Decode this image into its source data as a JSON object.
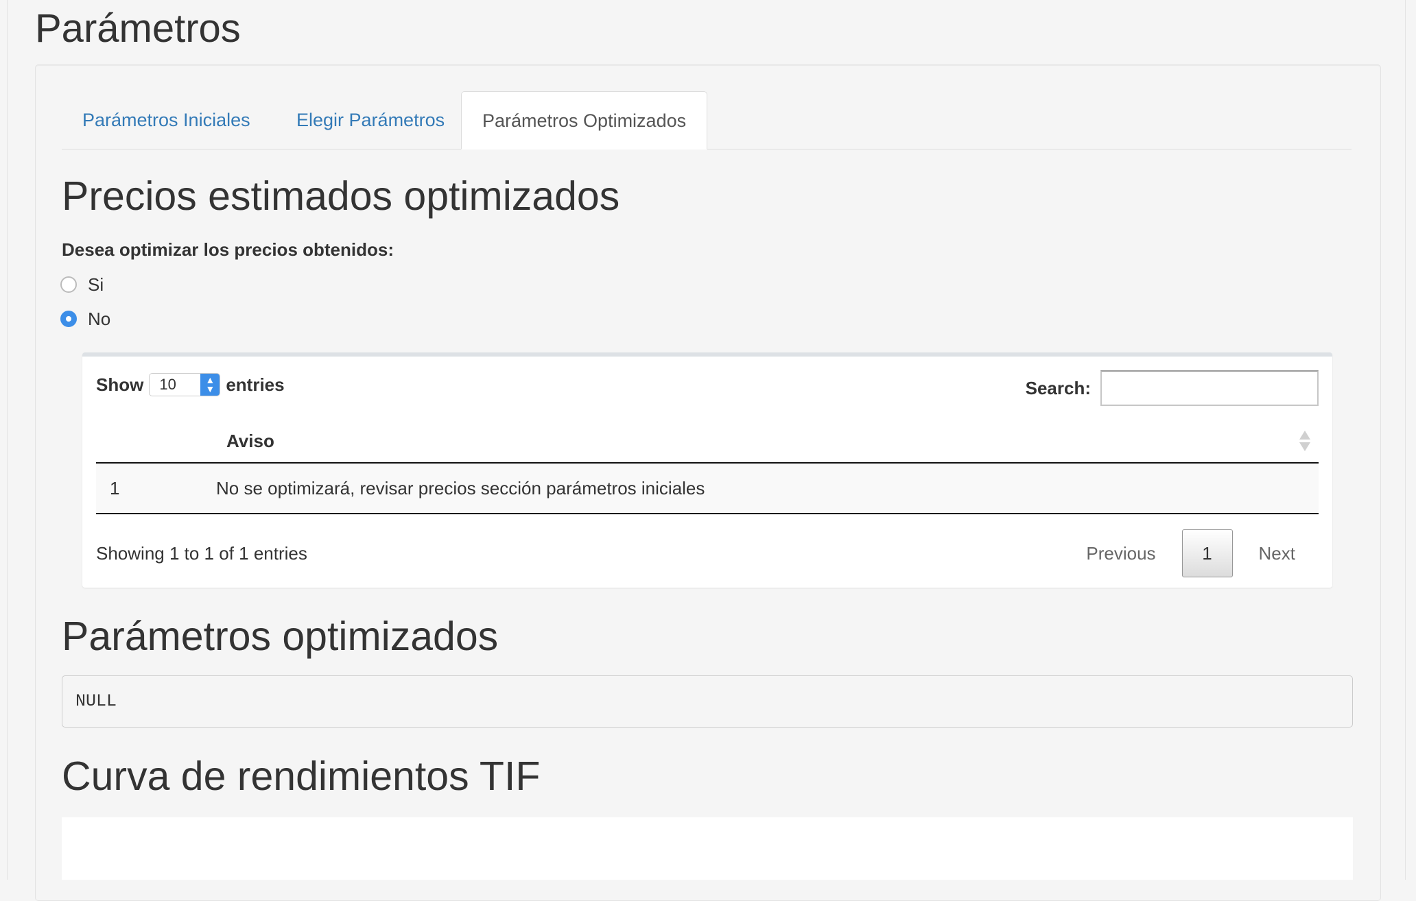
{
  "page_title": "Parámetros",
  "tabs": [
    {
      "label": "Parámetros Iniciales",
      "active": false
    },
    {
      "label": "Elegir Parámetros",
      "active": false
    },
    {
      "label": "Parámetros Optimizados",
      "active": true
    }
  ],
  "section1": {
    "title": "Precios estimados optimizados",
    "question": "Desea optimizar los precios obtenidos:",
    "options": [
      {
        "label": "Si",
        "checked": false
      },
      {
        "label": "No",
        "checked": true
      }
    ]
  },
  "datatable": {
    "show_label": "Show",
    "length_value": "10",
    "entries_label": "entries",
    "search_label": "Search:",
    "search_value": "",
    "columns": [
      "",
      "Aviso"
    ],
    "rows": [
      [
        "1",
        "No se optimizará, revisar precios sección parámetros iniciales"
      ]
    ],
    "info": "Showing 1 to 1 of 1 entries",
    "pagination": {
      "previous": "Previous",
      "current": "1",
      "next": "Next"
    }
  },
  "section2": {
    "title": "Parámetros optimizados",
    "output": "NULL"
  },
  "section3": {
    "title": "Curva de rendimientos TIF"
  },
  "colors": {
    "link": "#337ab7",
    "radio_accent": "#3c8ee8",
    "background": "#f5f5f5"
  }
}
